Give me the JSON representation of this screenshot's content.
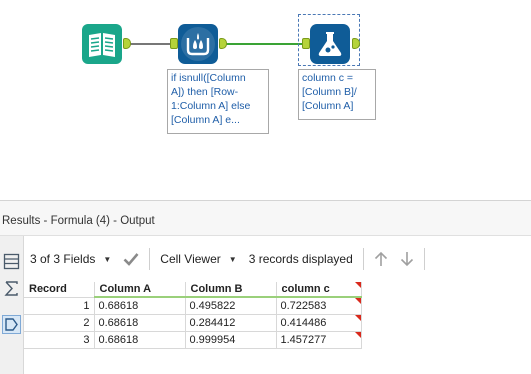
{
  "canvas": {
    "tools": [
      {
        "name": "input-data-tool",
        "icon": "book-icon",
        "color": "#1aa68a"
      },
      {
        "name": "multi-row-formula-tool",
        "icon": "multi-row-formula-icon",
        "color": "#0f5c97"
      },
      {
        "name": "formula-tool",
        "icon": "flask-icon",
        "color": "#0f5c97"
      }
    ],
    "annotations": {
      "multirow": "if isnull([Column\nA]) then [Row-\n1:Column A] else\n[Column A] e...",
      "formula": "column c =\n[Column B]/\n[Column A]"
    },
    "connection_colors": {
      "default": "#777777",
      "success": "#3aa335"
    },
    "anchor_color": "#b5d33a"
  },
  "results": {
    "title": "Results - Formula (4) - Output",
    "toolbar": {
      "fields_label": "3 of 3 Fields",
      "cell_viewer_label": "Cell Viewer",
      "records_label": "3 records displayed"
    },
    "grid": {
      "columns": [
        "Record",
        "Column A",
        "Column B",
        "column c"
      ],
      "rows": [
        {
          "record": "1",
          "a": "0.68618",
          "b": "0.495822",
          "c": "0.722583"
        },
        {
          "record": "2",
          "a": "0.68618",
          "b": "0.284412",
          "c": "0.414486"
        },
        {
          "record": "3",
          "a": "0.68618",
          "b": "0.999954",
          "c": "1.457277"
        }
      ]
    }
  }
}
